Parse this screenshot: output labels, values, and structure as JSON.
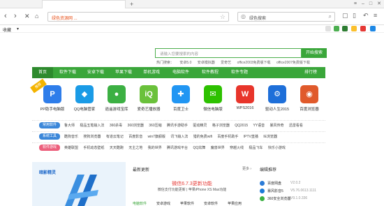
{
  "browser": {
    "address_url": "绿色资源网 ...",
    "search_engine_label": "绿色搜索",
    "favorites_label": "收藏"
  },
  "page": {
    "search": {
      "placeholder": "请输入您要搜索的内容",
      "button": "开始搜索"
    },
    "hot": {
      "label": "热门搜索：",
      "items": [
        "安卓5.0",
        "安卓模拟器",
        "爱奇艺",
        "office2003免费版下载",
        "office2007免费版下载"
      ]
    },
    "nav": [
      "首页",
      "软件下载",
      "安卓下载",
      "苹果下载",
      "单机游戏",
      "电脑软件",
      "软件教程",
      "软件专题",
      "排行榜"
    ],
    "ribbon": "推荐",
    "apps": [
      {
        "name": "PP助手电脑版",
        "glyph": "P",
        "color": "#2e7dea"
      },
      {
        "name": "QQ电脑管家",
        "glyph": "◆",
        "color": "#1a9be6"
      },
      {
        "name": "逍遥游戏宝库",
        "glyph": "●",
        "color": "#3cb043"
      },
      {
        "name": "爱奇艺播放器",
        "glyph": "iQ",
        "color": "#6ac13b"
      },
      {
        "name": "百度卫士",
        "glyph": "✚",
        "color": "#2196f3"
      },
      {
        "name": "微信电脑版",
        "glyph": "✉",
        "color": "#2dc100"
      },
      {
        "name": "WPS2016",
        "glyph": "W",
        "color": "#e8352b"
      },
      {
        "name": "驱动人生2015",
        "glyph": "⚙",
        "color": "#1e6fd9"
      },
      {
        "name": "百度浏览器",
        "glyph": "◉",
        "color": "#e05a2b"
      }
    ],
    "rows": [
      {
        "tag": "常用软件",
        "color": "#3b87d9",
        "items": [
          "鲁大师",
          "极品五笔输入法",
          "360杀毒",
          "360浏览器",
          "360压缩",
          "腾讯手游助手",
          "驱动精灵",
          "格子浏览器",
          "QQ2015",
          "YY语音",
          "暴风传奇",
          "迅雷看看"
        ]
      },
      {
        "tag": "系统工具",
        "color": "#3b87d9",
        "items": [
          "酷狗音乐",
          "搜狗浏览器",
          "有道云笔记",
          "百度影音",
          "win7旗舰版",
          "讯飞输入法",
          "猎豹免费wifi",
          "百度手机助手",
          "IPTV直播",
          "IE浏览器"
        ]
      },
      {
        "tag": "软件游戏",
        "color": "#ec5f7c",
        "items": [
          "英雄联盟",
          "手机动态壁纸",
          "天天酷跑",
          "无主之地",
          "我的世界",
          "腾讯游戏平台",
          "QQ炫舞",
          "魔兽世界",
          "穿越火线",
          "极品飞车",
          "快乐小游戏"
        ]
      }
    ],
    "banner_logo": "暗影精灵",
    "news": {
      "head": "最新更新",
      "more": "更多 ›",
      "headline": "微信6.7.3更新功能",
      "sub": "微信支付功能更新 | 苹果iPhone XS Max功能",
      "tabs": [
        "电脑软件",
        "安卓游戏",
        "苹果软件",
        "安卓软件",
        "苹果应用"
      ]
    },
    "rank": {
      "head": "编辑推荐",
      "items": [
        {
          "name": "百度网盘",
          "ver": "V2.0.2",
          "color": "#2b7bd6"
        },
        {
          "name": "暴风影音5",
          "ver": "V5.76.0613.1111",
          "color": "#1c7ad6"
        },
        {
          "name": "360安全浏览器",
          "ver": "V9.1.0.336",
          "color": "#3cb043"
        }
      ]
    }
  }
}
